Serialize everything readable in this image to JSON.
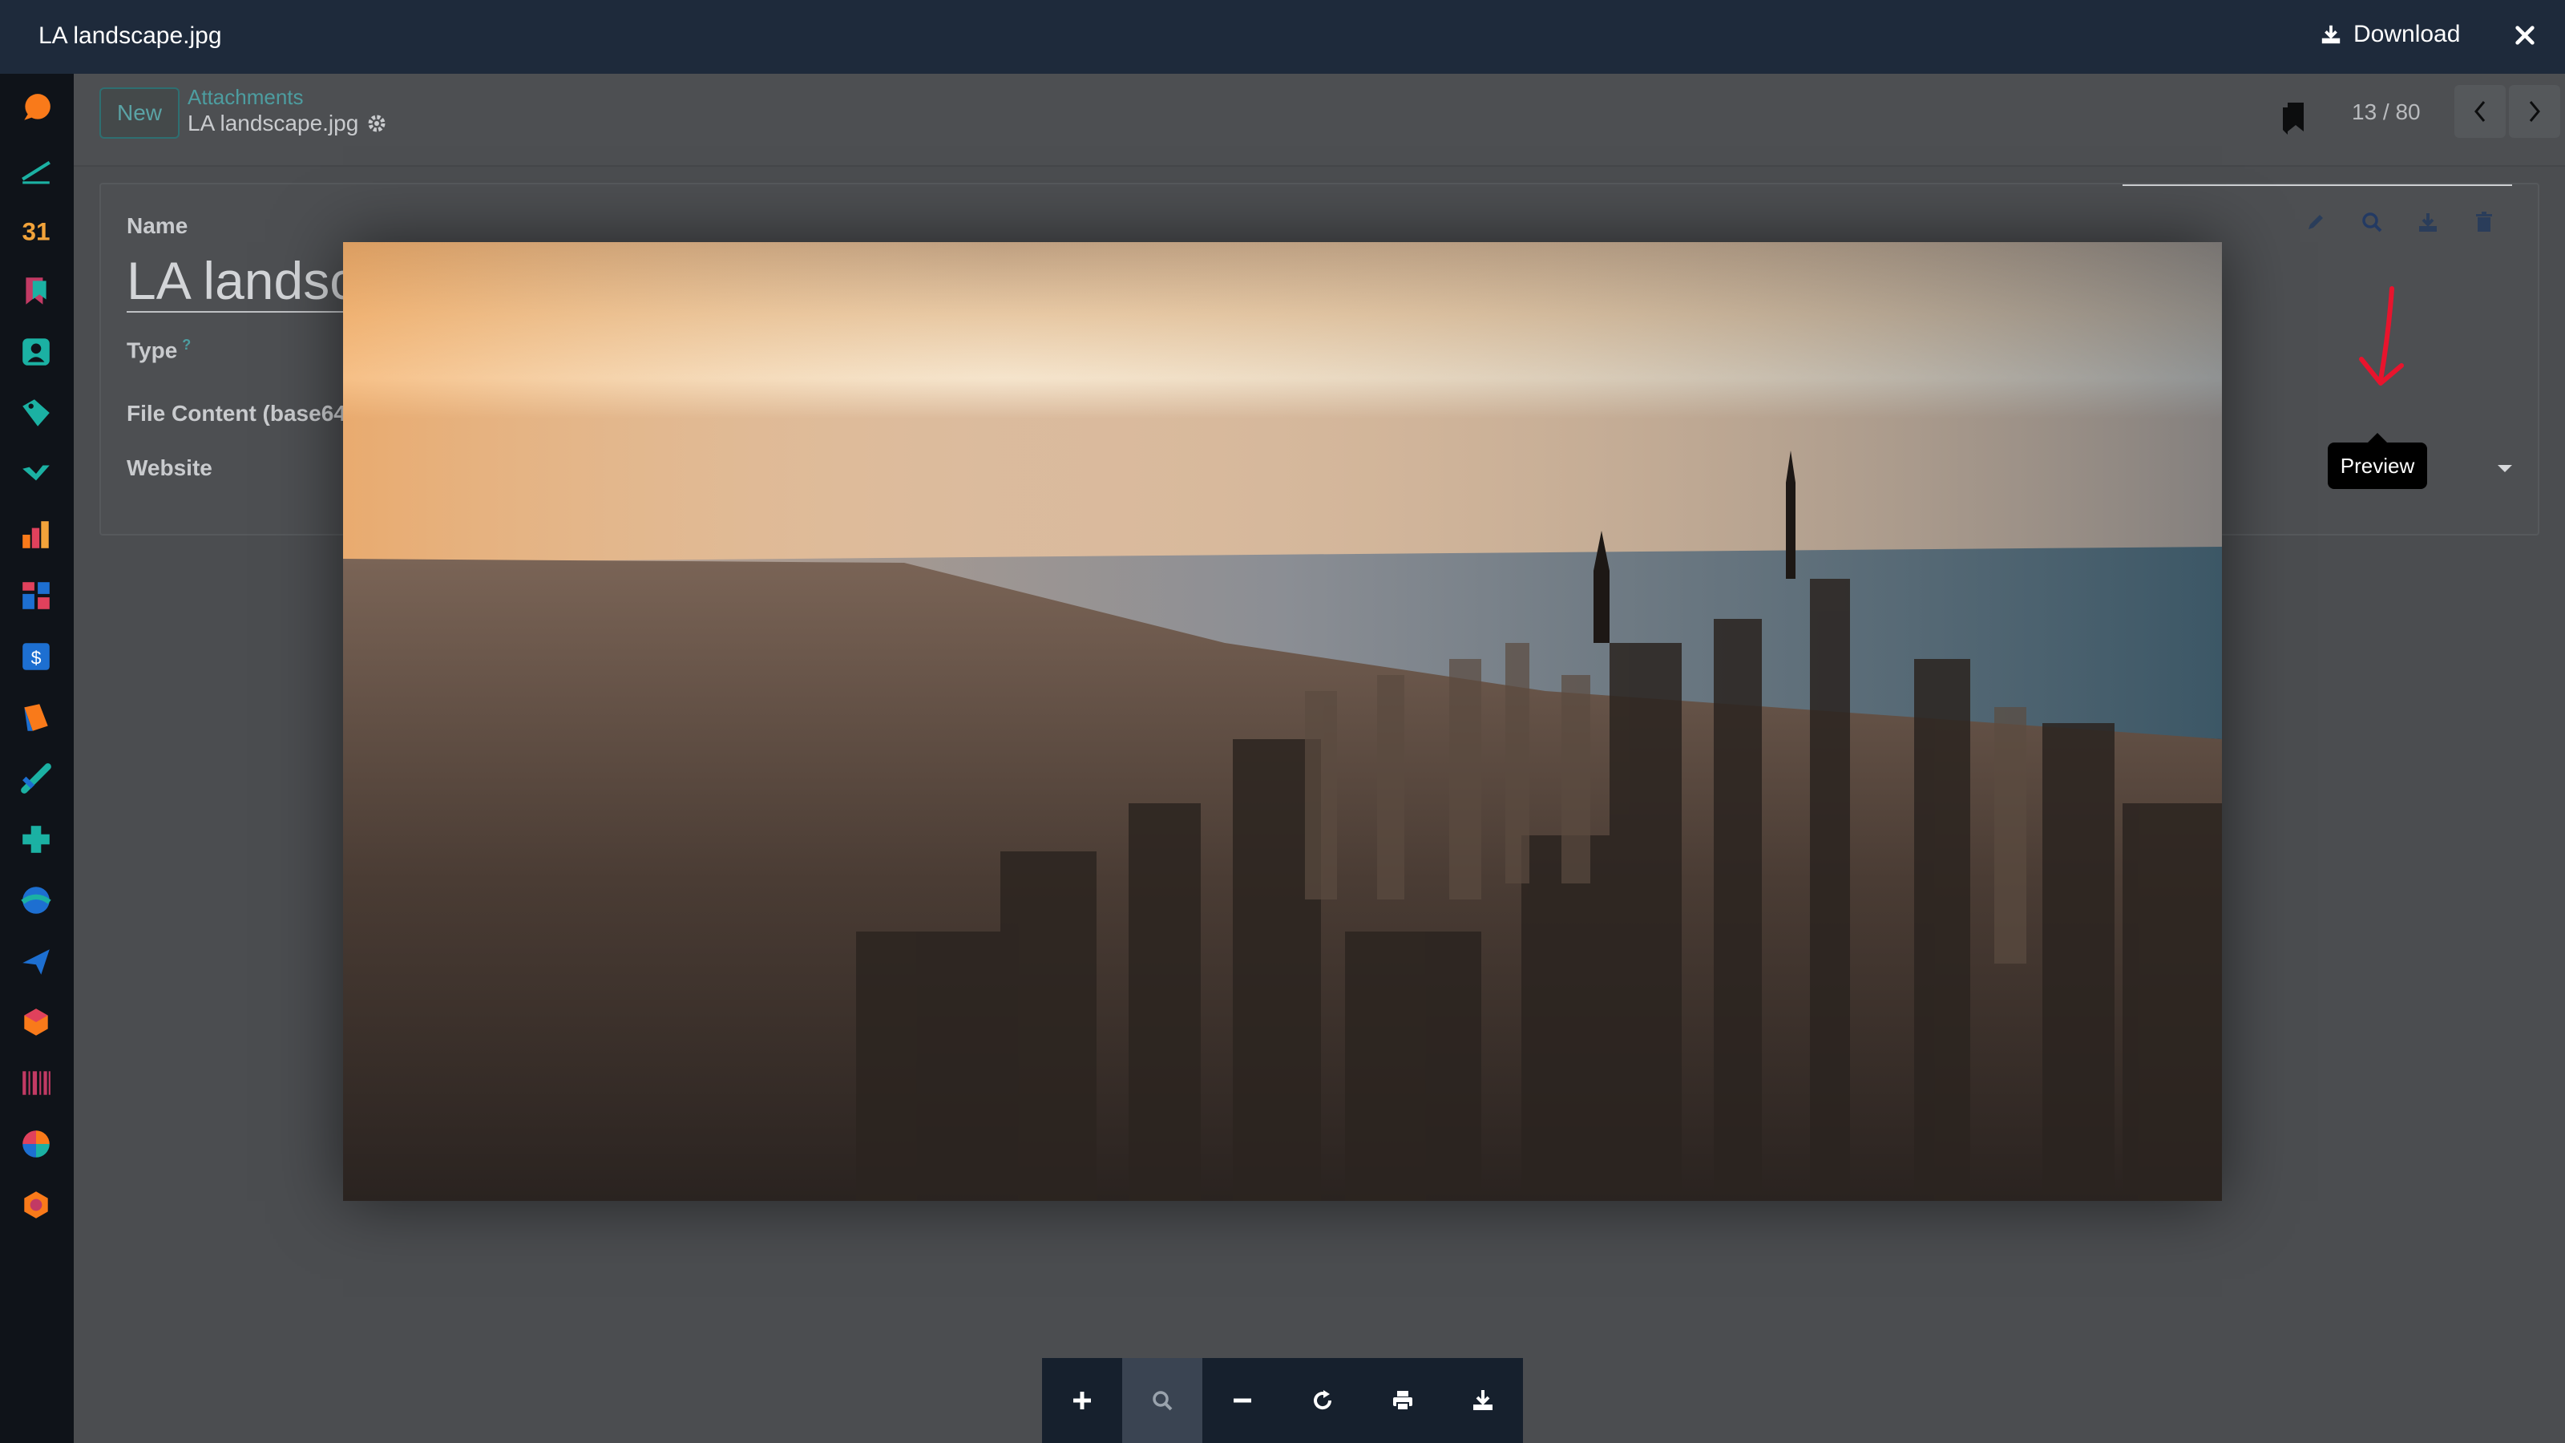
{
  "header": {
    "file_name": "LA landscape.jpg",
    "download_label": "Download",
    "download_icon": "download-icon",
    "close_icon": "close-icon"
  },
  "control_panel": {
    "new_label": "New",
    "breadcrumb_parent": "Attachments",
    "breadcrumb_current": "LA landscape.jpg",
    "pager_value": "13 / 80"
  },
  "form": {
    "name_label": "Name",
    "name_value": "LA landsc",
    "type_label": "Type",
    "type_help": "?",
    "file_content_label": "File Content (base64)",
    "website_label": "Website"
  },
  "tooltip": {
    "text": "Preview"
  },
  "toolbar": {
    "buttons": [
      "zoom-in-icon",
      "zoom-reset-icon",
      "zoom-out-icon",
      "rotate-icon",
      "print-icon",
      "download-icon"
    ],
    "active": "zoom-reset-icon"
  },
  "sidebar": {
    "apps": [
      "discuss-icon",
      "to-do-icon",
      "calendar-icon",
      "knowledge-icon",
      "contacts-icon",
      "crm-icon",
      "sales-icon",
      "dashboards-icon",
      "website-icon",
      "accounting-icon",
      "documents-icon",
      "project-icon",
      "helpdesk-icon",
      "field-service-icon",
      "email-marketing-icon",
      "inventory-icon",
      "barcode-icon",
      "apps-icon",
      "settings-icon"
    ],
    "calendar_text": "31"
  },
  "colors": {
    "header_bg": "#1e2a3b",
    "sidebar_bg": "#0f1319",
    "accent": "#2e6f71",
    "arrow": "#e8142d"
  }
}
